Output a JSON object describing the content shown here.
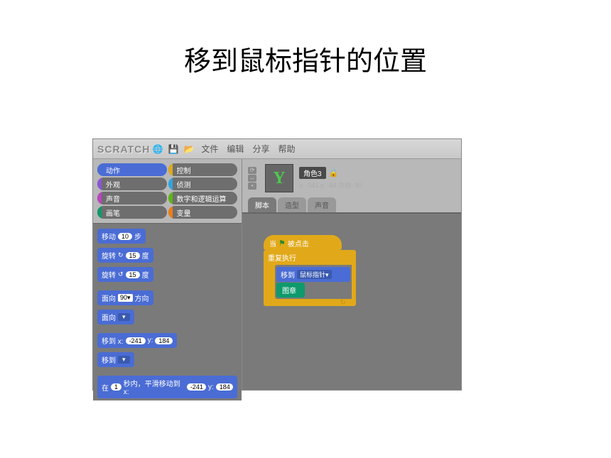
{
  "page_title": "移到鼠标指针的位置",
  "titlebar": {
    "logo": "SCRATCH",
    "menus": [
      "文件",
      "编辑",
      "分享",
      "帮助"
    ]
  },
  "categories": [
    {
      "label": "动作",
      "class": "cat-motion active"
    },
    {
      "label": "控制",
      "class": "cat-control"
    },
    {
      "label": "外观",
      "class": "cat-looks"
    },
    {
      "label": "侦测",
      "class": "cat-sensing"
    },
    {
      "label": "声音",
      "class": "cat-sound"
    },
    {
      "label": "数字和逻辑运算",
      "class": "cat-operators"
    },
    {
      "label": "画笔",
      "class": "cat-pen"
    },
    {
      "label": "变量",
      "class": "cat-variables"
    }
  ],
  "palette": {
    "move": {
      "prefix": "移动",
      "val": "10",
      "suffix": "步"
    },
    "turn_cw": {
      "prefix": "旋转",
      "icon": "↻",
      "val": "15",
      "suffix": "度"
    },
    "turn_ccw": {
      "prefix": "旋转",
      "icon": "↺",
      "val": "15",
      "suffix": "度"
    },
    "point_dir": {
      "prefix": "面向",
      "val": "90▾",
      "suffix": "方向"
    },
    "point_to": {
      "prefix": "面向",
      "dd": "▾"
    },
    "goto_xy": {
      "prefix": "移到 x:",
      "x": "-241",
      "mid": "y:",
      "y": "184"
    },
    "goto": {
      "prefix": "移到",
      "dd": "▾"
    },
    "glide": {
      "p1": "在",
      "sec": "1",
      "p2": "秒内，平滑移动到 x:",
      "x": "-241",
      "p3": "y:",
      "y": "184"
    }
  },
  "sprite": {
    "name": "角色3",
    "coords": "x: -241 y: -84   方向: 90"
  },
  "tabs": [
    "脚本",
    "造型",
    "声音"
  ],
  "script": {
    "hat": {
      "when": "当",
      "clicked": "被点击"
    },
    "forever": "重复执行",
    "goto": {
      "prefix": "移到",
      "target": "鼠标指针▾"
    },
    "stamp": "图章"
  }
}
